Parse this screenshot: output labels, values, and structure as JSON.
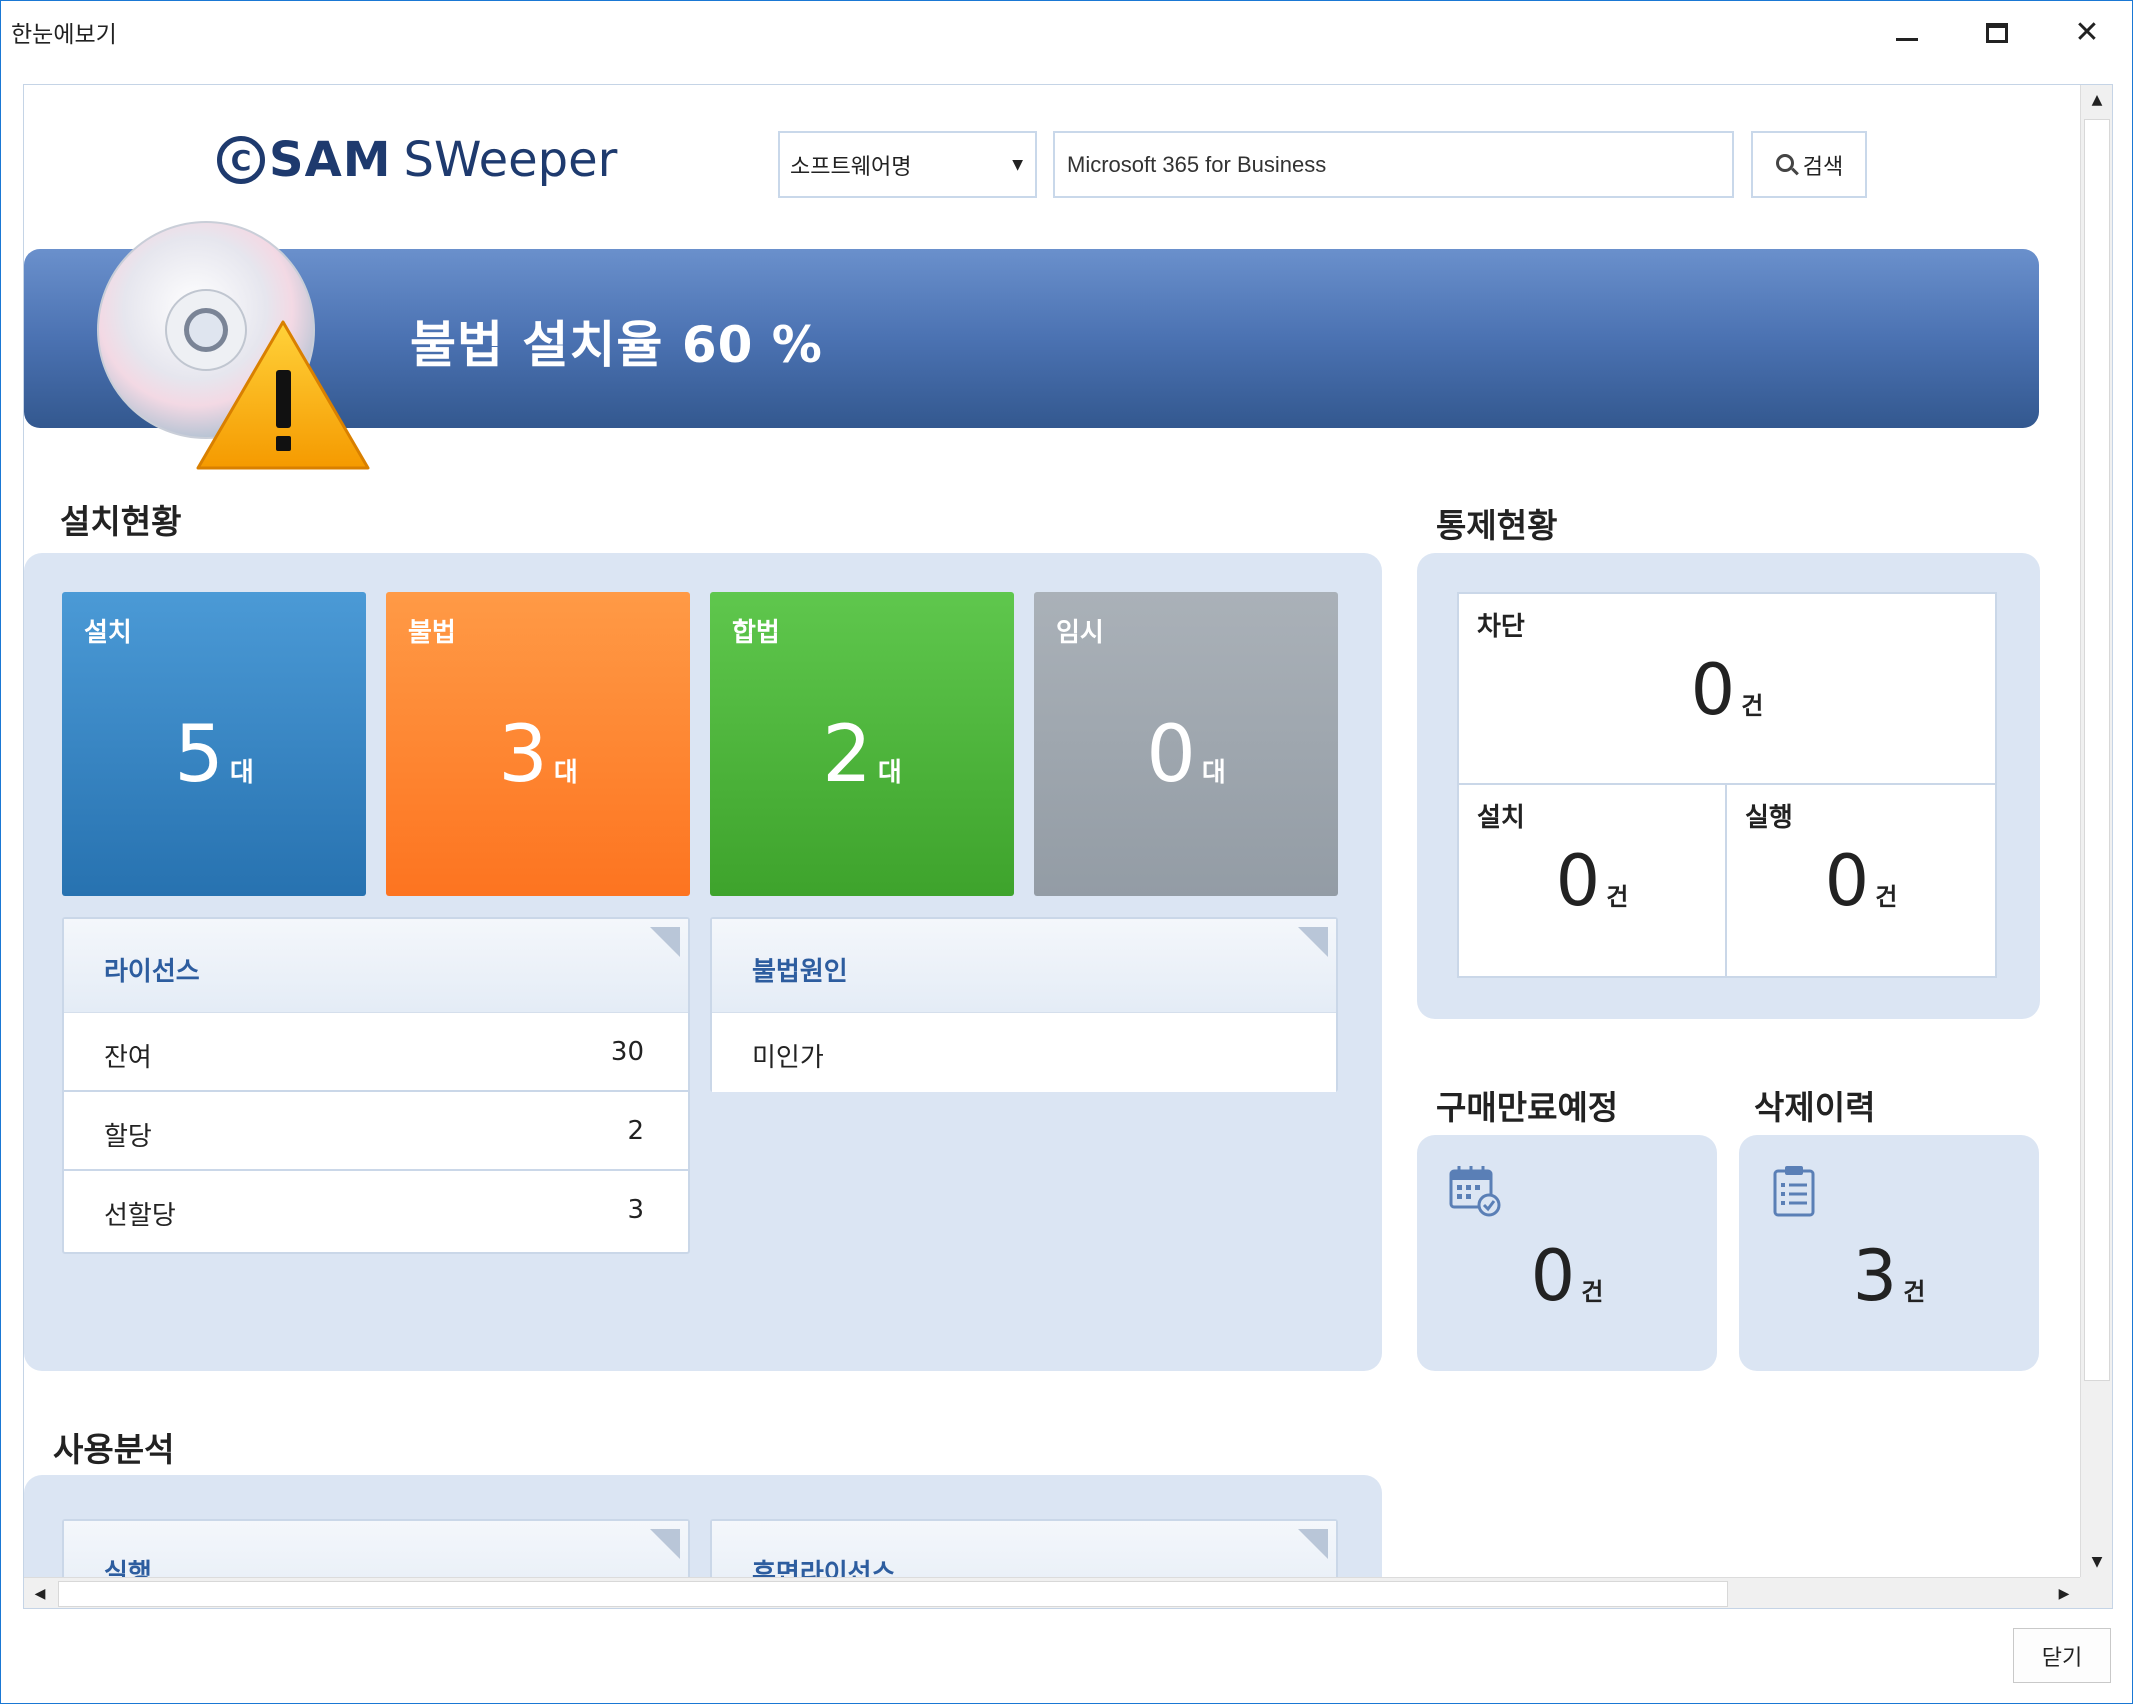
{
  "window": {
    "title": "한눈에보기"
  },
  "header": {
    "logo": {
      "mark": "C",
      "brand_bold": "SAM",
      "brand_light": "SWeeper"
    },
    "search_type": "소프트웨어명",
    "search_value": "Microsoft 365 for Business",
    "search_button_label": "검색"
  },
  "banner": {
    "title": "불법 설치율 60 %"
  },
  "install_status": {
    "title": "설치현황",
    "tiles": [
      {
        "label": "설치",
        "value": "5",
        "unit": "대",
        "color": "#2e7cbf"
      },
      {
        "label": "불법",
        "value": "3",
        "unit": "대",
        "color": "#fd7f2c"
      },
      {
        "label": "합법",
        "value": "2",
        "unit": "대",
        "color": "#4cb43a"
      },
      {
        "label": "임시",
        "value": "0",
        "unit": "대",
        "color": "#9aa2aa"
      }
    ],
    "license_card": {
      "title": "라이선스",
      "rows": [
        {
          "label": "잔여",
          "value": "30"
        },
        {
          "label": "할당",
          "value": "2"
        },
        {
          "label": "선할당",
          "value": "3"
        }
      ]
    },
    "illegal_reason_card": {
      "title": "불법원인",
      "rows": [
        {
          "label": "미인가"
        }
      ]
    }
  },
  "control_status": {
    "title": "통제현황",
    "block": {
      "label": "차단",
      "value": "0",
      "unit": "건"
    },
    "install": {
      "label": "설치",
      "value": "0",
      "unit": "건"
    },
    "run": {
      "label": "실행",
      "value": "0",
      "unit": "건"
    }
  },
  "purchase_expiry": {
    "title": "구매만료예정",
    "value": "0",
    "unit": "건",
    "icon": "calendar-check-icon"
  },
  "deletion_history": {
    "title": "삭제이력",
    "value": "3",
    "unit": "건",
    "icon": "clipboard-list-icon"
  },
  "usage_analysis": {
    "title": "사용분석",
    "cards": [
      {
        "title": "실행"
      },
      {
        "title": "휴면라이선스"
      }
    ]
  },
  "footer": {
    "close_button_label": "닫기"
  },
  "colors": {
    "accent": "#4b72b2",
    "panel": "#dbe5f3",
    "card_title": "#2d5d9f"
  }
}
